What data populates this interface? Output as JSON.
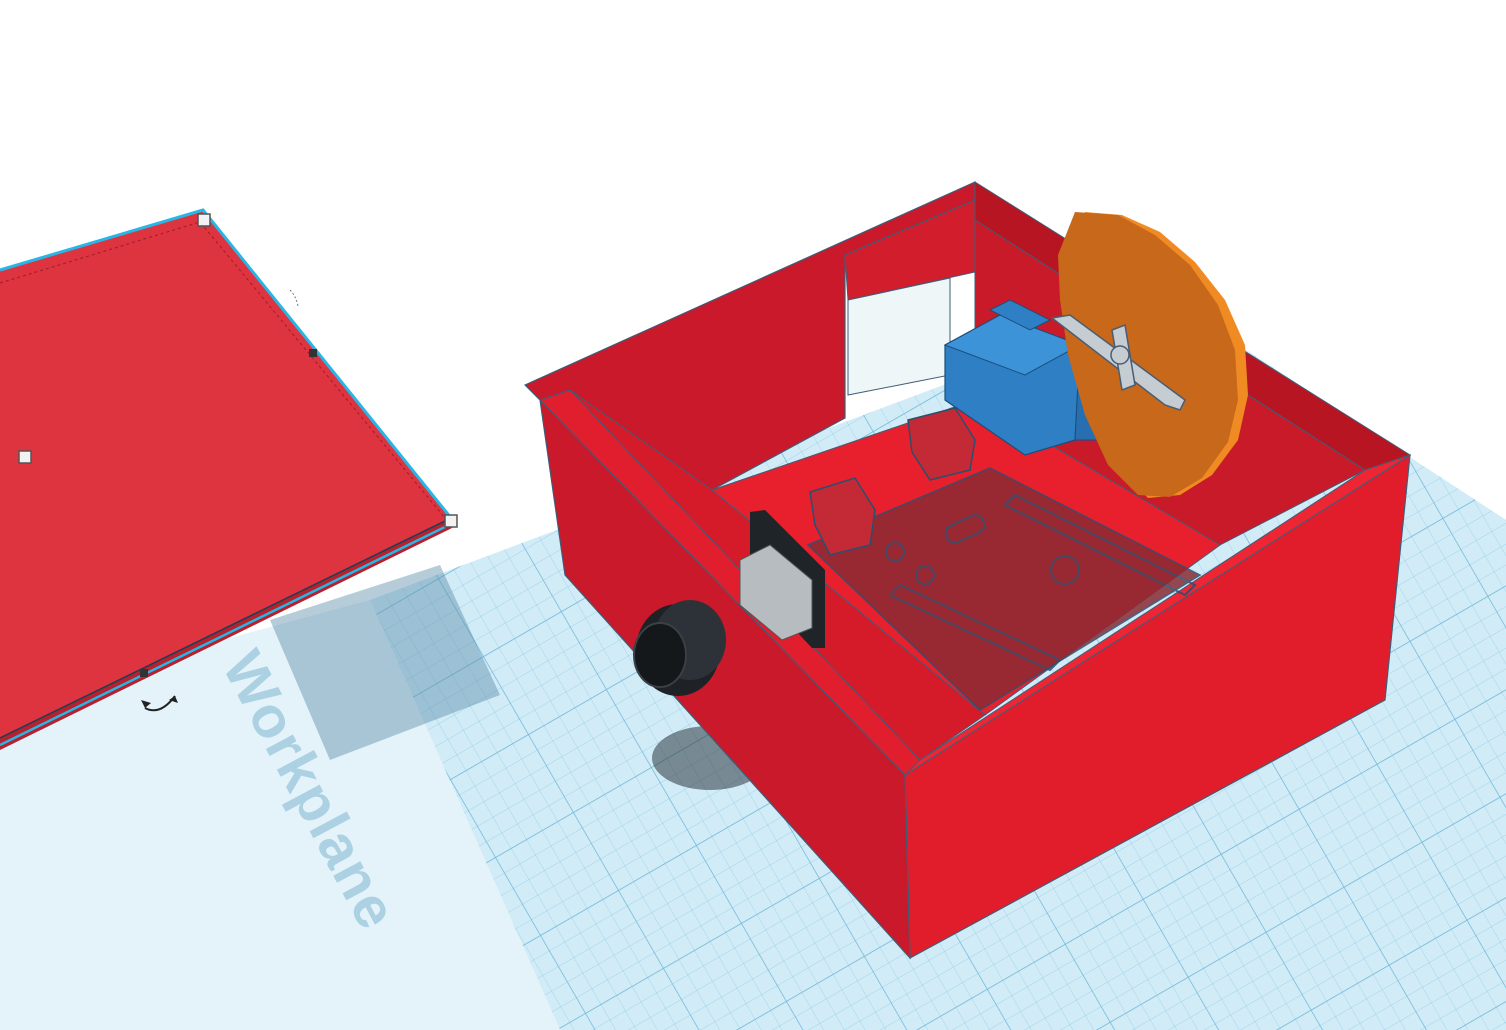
{
  "workplane": {
    "label": "Workplane"
  },
  "colors": {
    "workplane_fill": "#d2ecf7",
    "grid_line": "#8ecbe6",
    "box_red": "#d81d2b",
    "box_dark": "#b81522",
    "lid_red": "#dd3440",
    "servo_blue": "#2f7fc4",
    "disc_orange": "#c76a1a",
    "knob_black": "#1e2226",
    "selection_cyan": "#27b6e6"
  },
  "icons": {
    "rotate_handle": "rotate-arrow-icon",
    "resize_handle": "square-handle-icon"
  }
}
